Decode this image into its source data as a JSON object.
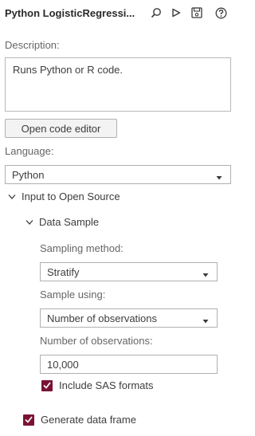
{
  "header": {
    "title": "Python LogisticRegressi...",
    "icons": [
      "search-icon",
      "run-icon",
      "save-icon",
      "help-icon"
    ]
  },
  "description": {
    "label": "Description:",
    "value": "Runs Python or R code."
  },
  "open_editor_button": "Open code editor",
  "language": {
    "label": "Language:",
    "selected": "Python"
  },
  "input_section": {
    "title": "Input to Open Source",
    "data_sample": {
      "title": "Data Sample",
      "sampling_method": {
        "label": "Sampling method:",
        "selected": "Stratify"
      },
      "sample_using": {
        "label": "Sample using:",
        "selected": "Number of observations"
      },
      "num_observations": {
        "label": "Number of observations:",
        "value": "10,000"
      },
      "include_sas_formats": {
        "label": "Include SAS formats",
        "checked": true
      }
    }
  },
  "generate_data_frame": {
    "label": "Generate data frame",
    "checked": true
  },
  "colors": {
    "accent": "#7a1333",
    "border": "#b0b0b0"
  }
}
